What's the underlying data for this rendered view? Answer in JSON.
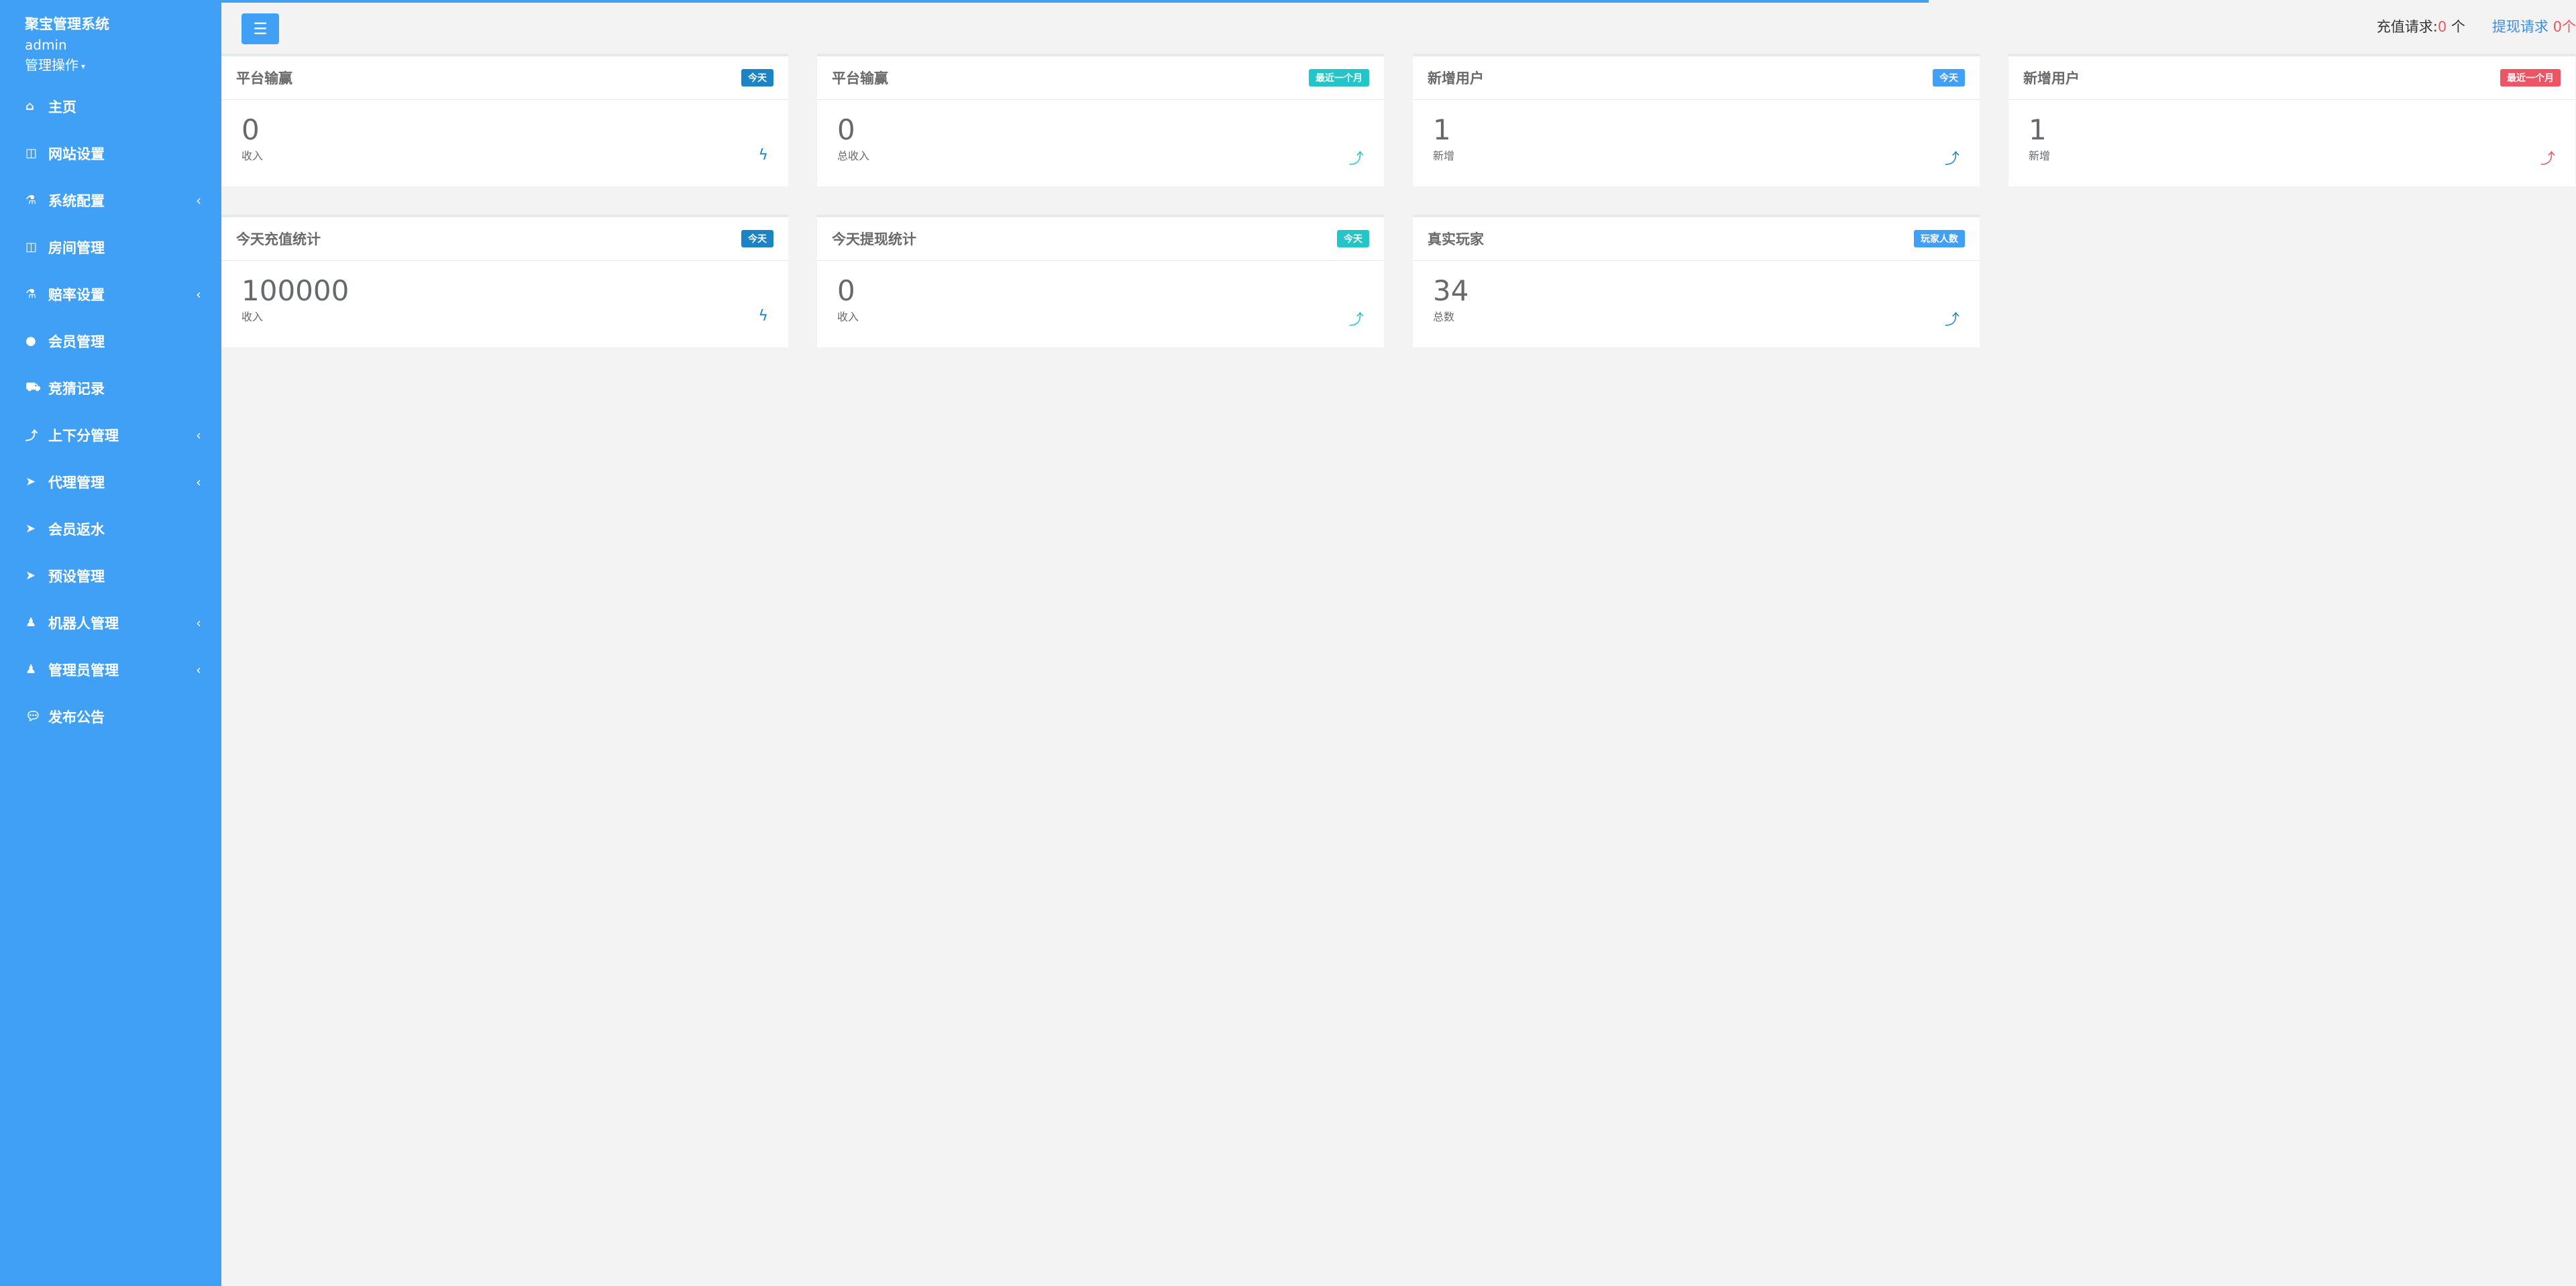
{
  "sidebar": {
    "title": "聚宝管理系统",
    "user": "admin",
    "ops_label": "管理操作",
    "items": [
      {
        "label": "主页",
        "icon": "home-icon",
        "has_arrow": false
      },
      {
        "label": "网站设置",
        "icon": "columns-icon",
        "has_arrow": false
      },
      {
        "label": "系统配置",
        "icon": "flask-icon",
        "has_arrow": true
      },
      {
        "label": "房间管理",
        "icon": "columns-icon",
        "has_arrow": false
      },
      {
        "label": "赔率设置",
        "icon": "flask-icon",
        "has_arrow": true
      },
      {
        "label": "会员管理",
        "icon": "user-icon",
        "has_arrow": false
      },
      {
        "label": "竞猜记录",
        "icon": "car-icon",
        "has_arrow": false
      },
      {
        "label": "上下分管理",
        "icon": "level-up-icon",
        "has_arrow": true
      },
      {
        "label": "代理管理",
        "icon": "paper-plane-icon",
        "has_arrow": true
      },
      {
        "label": "会员返水",
        "icon": "paper-plane-icon",
        "has_arrow": false
      },
      {
        "label": "预设管理",
        "icon": "paper-plane-icon",
        "has_arrow": false
      },
      {
        "label": "机器人管理",
        "icon": "person-icon",
        "has_arrow": true
      },
      {
        "label": "管理员管理",
        "icon": "person-icon",
        "has_arrow": true
      },
      {
        "label": "发布公告",
        "icon": "comment-icon",
        "has_arrow": false
      }
    ]
  },
  "topbar": {
    "recharge_label": "充值请求:",
    "recharge_count": "0",
    "recharge_unit": " 个",
    "withdraw_label": "提现请求 ",
    "withdraw_count": "0",
    "withdraw_unit": "个"
  },
  "cards": [
    {
      "title": "平台输赢",
      "badge": "今天",
      "badge_color": "#1c84c6",
      "value": "0",
      "sub": "收入",
      "icon": "bolt-icon",
      "icon_color": "#1c84c6"
    },
    {
      "title": "平台输赢",
      "badge": "最近一个月",
      "badge_color": "#23c6c8",
      "value": "0",
      "sub": "总收入",
      "icon": "level-up-icon",
      "icon_color": "#23c6c8"
    },
    {
      "title": "新增用户",
      "badge": "今天",
      "badge_color": "#3fa0f6",
      "value": "1",
      "sub": "新增",
      "icon": "level-up-icon",
      "icon_color": "#1c84c6"
    },
    {
      "title": "新增用户",
      "badge": "最近一个月",
      "badge_color": "#ed5565",
      "value": "1",
      "sub": "新增",
      "icon": "level-up-icon",
      "icon_color": "#ed5565"
    },
    {
      "title": "今天充值统计",
      "badge": "今天",
      "badge_color": "#1c84c6",
      "value": "100000",
      "sub": "收入",
      "icon": "bolt-icon",
      "icon_color": "#1c84c6"
    },
    {
      "title": "今天提现统计",
      "badge": "今天",
      "badge_color": "#23c6c8",
      "value": "0",
      "sub": "收入",
      "icon": "level-up-icon",
      "icon_color": "#23c6c8"
    },
    {
      "title": "真实玩家",
      "badge": "玩家人数",
      "badge_color": "#3fa0f6",
      "value": "34",
      "sub": "总数",
      "icon": "level-up-icon",
      "icon_color": "#1c84c6"
    }
  ]
}
